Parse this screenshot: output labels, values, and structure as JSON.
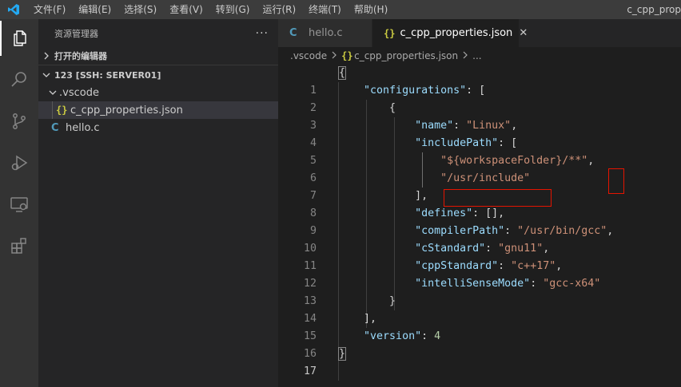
{
  "menu": [
    "文件(F)",
    "编辑(E)",
    "选择(S)",
    "查看(V)",
    "转到(G)",
    "运行(R)",
    "终端(T)",
    "帮助(H)"
  ],
  "window_title": "c_cpp_prop",
  "activity_icons": [
    "explorer-icon",
    "search-icon",
    "source-control-icon",
    "run-debug-icon",
    "remote-explorer-icon",
    "extensions-icon"
  ],
  "sidebar": {
    "title": "资源管理器",
    "more": "···",
    "open_editors": "打开的编辑器",
    "workspace": "123 [SSH: SERVER01]",
    "folder": ".vscode",
    "file_json": "c_cpp_properties.json",
    "file_c": "hello.c",
    "json_icon": "{}",
    "c_icon": "C"
  },
  "tabs": [
    {
      "label": "hello.c",
      "icon": "C"
    },
    {
      "label": "c_cpp_properties.json",
      "icon": "{}",
      "close": "✕"
    }
  ],
  "breadcrumb": {
    "folder": ".vscode",
    "file": "c_cpp_properties.json",
    "tail": "..."
  },
  "line_numbers": [
    "1",
    "2",
    "3",
    "4",
    "5",
    "6",
    "7",
    "8",
    "9",
    "10",
    "11",
    "12",
    "13",
    "14",
    "15",
    "16",
    "17"
  ],
  "code": {
    "l1_open": "{",
    "l2_key": "\"configurations\"",
    "l2_rest": ": [",
    "l3": "{",
    "l4_key": "\"name\"",
    "l4_colon": ": ",
    "l4_val": "\"Linux\"",
    "l4_end": ",",
    "l5_key": "\"includePath\"",
    "l5_rest": ": [",
    "l6_val": "\"${workspaceFolder}/**\"",
    "l6_end": ",",
    "l7_val": "\"/usr/include\"",
    "l8": "],",
    "l9_key": "\"defines\"",
    "l9_rest": ": [],",
    "l10_key": "\"compilerPath\"",
    "l10_colon": ": ",
    "l10_val": "\"/usr/bin/gcc\"",
    "l10_end": ",",
    "l11_key": "\"cStandard\"",
    "l11_colon": ": ",
    "l11_val": "\"gnu11\"",
    "l11_end": ",",
    "l12_key": "\"cppStandard\"",
    "l12_colon": ": ",
    "l12_val": "\"c++17\"",
    "l12_end": ",",
    "l13_key": "\"intelliSenseMode\"",
    "l13_colon": ": ",
    "l13_val": "\"gcc-x64\"",
    "l14": "}",
    "l15": "],",
    "l16_key": "\"version\"",
    "l16_colon": ": ",
    "l16_val": "4",
    "l17_close": "}"
  },
  "colors": {
    "accent": "#007acc",
    "highlight_box": "#e51400",
    "json_key": "#9cdcfe",
    "json_string": "#ce9178",
    "json_number": "#b5cea8"
  }
}
